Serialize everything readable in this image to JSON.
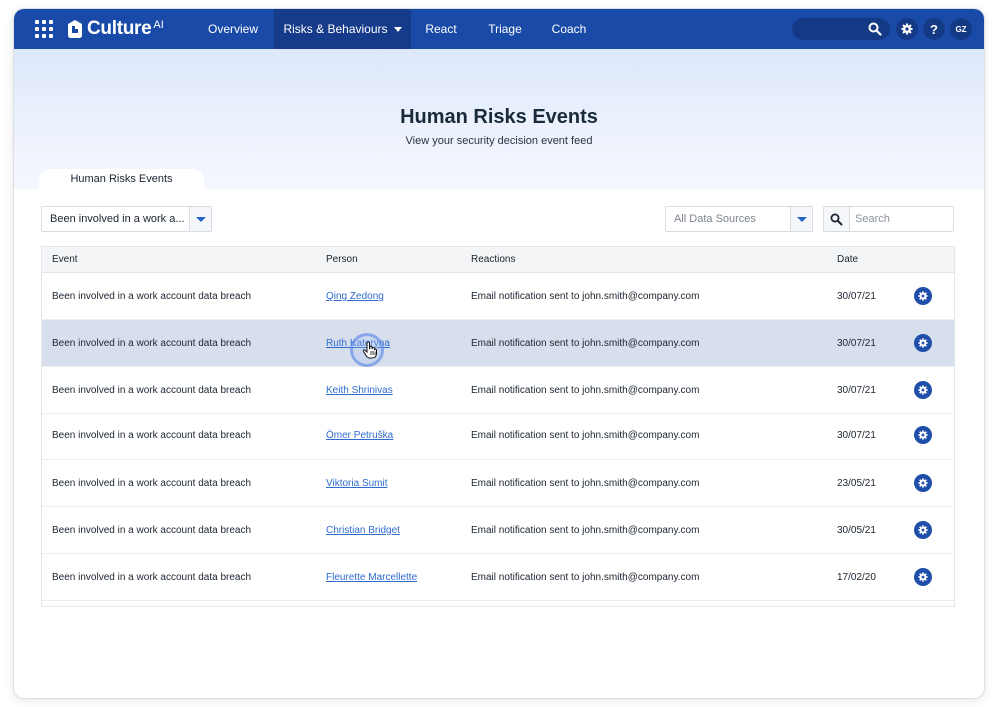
{
  "nav": {
    "brand": "Culture",
    "brand_suffix": "AI",
    "items": [
      {
        "label": "Overview"
      },
      {
        "label": "Risks & Behaviours",
        "active": true
      },
      {
        "label": "React"
      },
      {
        "label": "Triage"
      },
      {
        "label": "Coach"
      }
    ],
    "help_label": "?",
    "avatar_initials": "GZ"
  },
  "header": {
    "title": "Human Risks Events",
    "subtitle": "View your security decision event feed"
  },
  "tabs": [
    {
      "label": "Human Risks Events",
      "active": true
    }
  ],
  "filters": {
    "event_filter_value": "Been involved in a work a...",
    "data_source_value": "All Data Sources",
    "search_placeholder": "Search"
  },
  "table": {
    "columns": [
      "Event",
      "Person",
      "Reactions",
      "Date"
    ],
    "rows": [
      {
        "event": "Been involved in a work account data breach",
        "person": "Qing Zedong",
        "reaction": "Email notification sent to john.smith@company.com",
        "date": "30/07/21"
      },
      {
        "event": "Been involved in a work account data breach",
        "person": "Ruth Kateryna",
        "reaction": "Email notification sent to john.smith@company.com",
        "date": "30/07/21"
      },
      {
        "event": "Been involved in a work account data breach",
        "person": "Keith Shrinivas",
        "reaction": "Email notification sent to john.smith@company.com",
        "date": "30/07/21"
      },
      {
        "event": "Been involved in a work account data breach",
        "person": "Ömer Petruška",
        "reaction": "Email notification sent to john.smith@company.com",
        "date": "30/07/21"
      },
      {
        "event": "Been involved in a work account data breach",
        "person": "Viktoria Sumit",
        "reaction": "Email notification sent to john.smith@company.com",
        "date": "23/05/21"
      },
      {
        "event": "Been involved in a work account data breach",
        "person": "Christian Bridget",
        "reaction": "Email notification sent to john.smith@company.com",
        "date": "30/05/21"
      },
      {
        "event": "Been involved in a work account data breach",
        "person": "Fleurette Marcellette",
        "reaction": "Email notification sent to john.smith@company.com",
        "date": "17/02/20"
      }
    ]
  },
  "colors": {
    "nav_bg": "#1a4aa8",
    "accent": "#2563c9",
    "link": "#2f6ccf",
    "row_hover": "#d8dfec"
  }
}
